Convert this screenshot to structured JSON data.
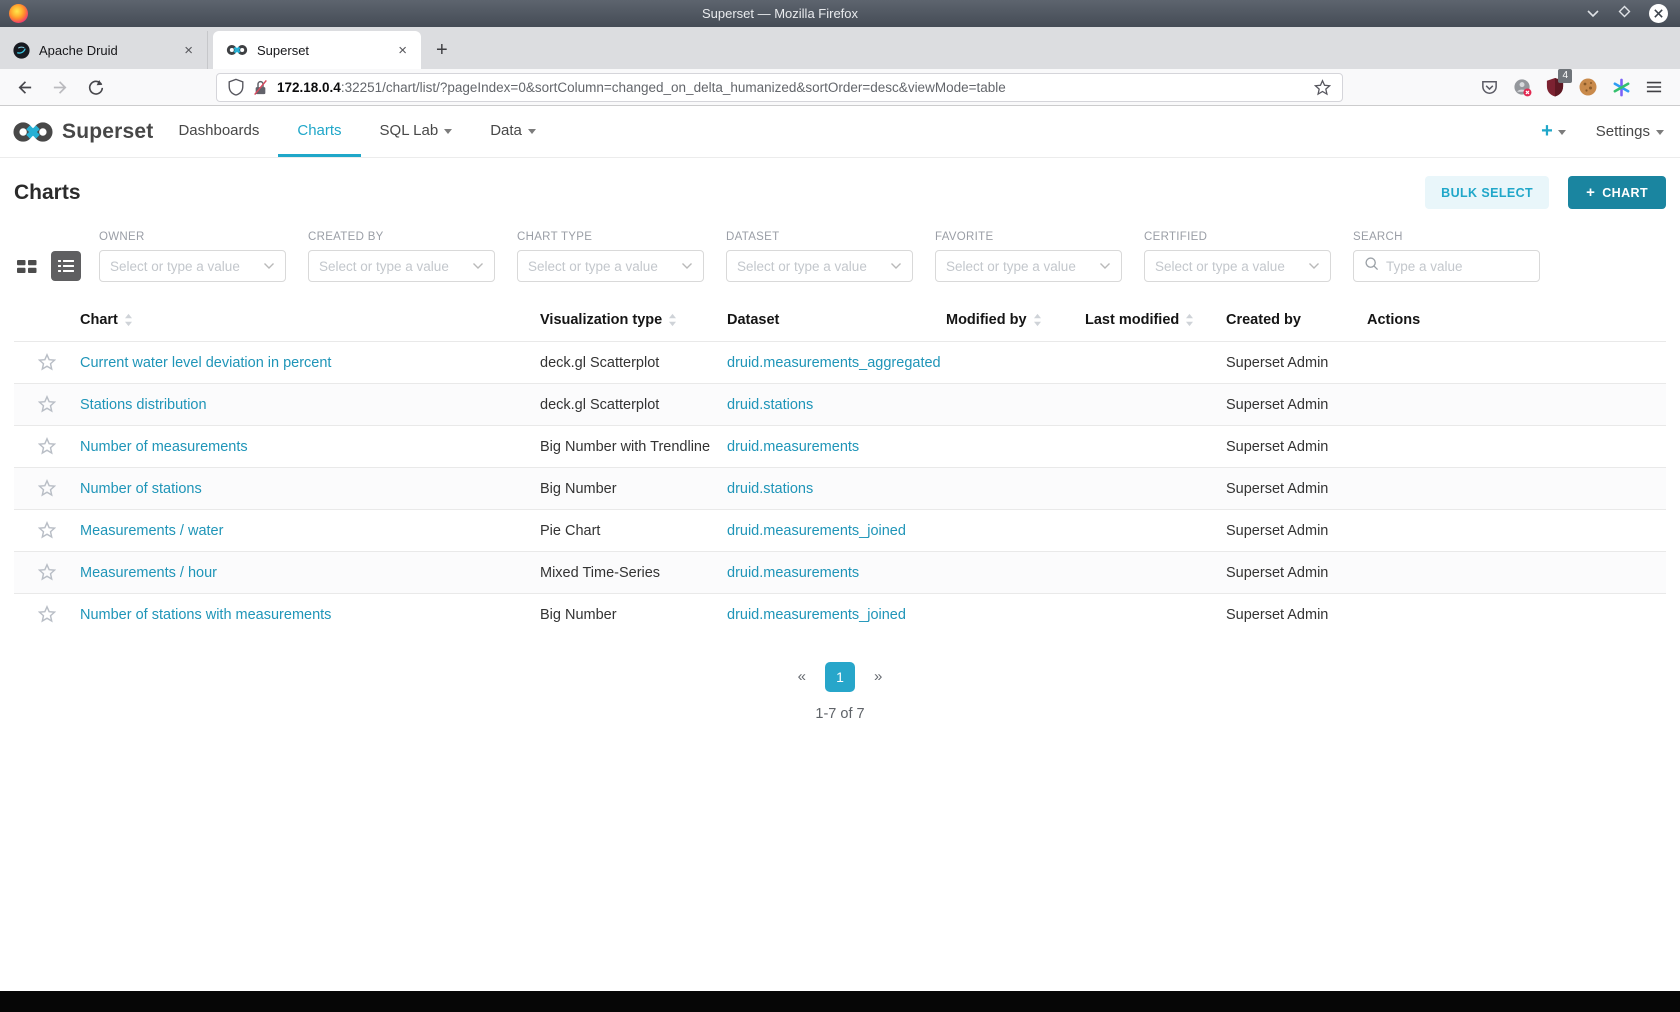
{
  "window": {
    "title": "Superset — Mozilla Firefox"
  },
  "browser": {
    "tabs": [
      {
        "label": "Apache Druid",
        "close_label": "×",
        "active": false
      },
      {
        "label": "Superset",
        "close_label": "×",
        "active": true
      }
    ],
    "new_tab_label": "+",
    "url_host": "172.18.0.4",
    "url_rest": ":32251/chart/list/?pageIndex=0&sortColumn=changed_on_delta_humanized&sortOrder=desc&viewMode=table",
    "extension_badge": "4"
  },
  "navbar": {
    "brand": "Superset",
    "items": [
      {
        "label": "Dashboards",
        "active": false,
        "caret": false
      },
      {
        "label": "Charts",
        "active": true,
        "caret": false
      },
      {
        "label": "SQL Lab",
        "active": false,
        "caret": true
      },
      {
        "label": "Data",
        "active": false,
        "caret": true
      }
    ],
    "plus_label": "+",
    "settings_label": "Settings"
  },
  "page": {
    "title": "Charts",
    "bulk_select_label": "BULK SELECT",
    "new_chart_plus": "+",
    "new_chart_label": "CHART"
  },
  "filters": [
    {
      "label": "OWNER",
      "placeholder": "Select or type a value",
      "type": "select"
    },
    {
      "label": "CREATED BY",
      "placeholder": "Select or type a value",
      "type": "select"
    },
    {
      "label": "CHART TYPE",
      "placeholder": "Select or type a value",
      "type": "select"
    },
    {
      "label": "DATASET",
      "placeholder": "Select or type a value",
      "type": "select"
    },
    {
      "label": "FAVORITE",
      "placeholder": "Select or type a value",
      "type": "select"
    },
    {
      "label": "CERTIFIED",
      "placeholder": "Select or type a value",
      "type": "select"
    },
    {
      "label": "SEARCH",
      "placeholder": "Type a value",
      "type": "search"
    }
  ],
  "table": {
    "columns": [
      {
        "label": "Chart",
        "sortable": true
      },
      {
        "label": "Visualization type",
        "sortable": true
      },
      {
        "label": "Dataset",
        "sortable": false
      },
      {
        "label": "Modified by",
        "sortable": true
      },
      {
        "label": "Last modified",
        "sortable": true
      },
      {
        "label": "Created by",
        "sortable": false
      },
      {
        "label": "Actions",
        "sortable": false
      }
    ],
    "rows": [
      {
        "chart": "Current water level deviation in percent",
        "visualization_type": "deck.gl Scatterplot",
        "dataset": "druid.measurements_aggregated",
        "modified_by": "",
        "last_modified": "",
        "created_by": "Superset Admin"
      },
      {
        "chart": "Stations distribution",
        "visualization_type": "deck.gl Scatterplot",
        "dataset": "druid.stations",
        "modified_by": "",
        "last_modified": "",
        "created_by": "Superset Admin"
      },
      {
        "chart": "Number of measurements",
        "visualization_type": "Big Number with Trendline",
        "dataset": "druid.measurements",
        "modified_by": "",
        "last_modified": "",
        "created_by": "Superset Admin"
      },
      {
        "chart": "Number of stations",
        "visualization_type": "Big Number",
        "dataset": "druid.stations",
        "modified_by": "",
        "last_modified": "",
        "created_by": "Superset Admin"
      },
      {
        "chart": "Measurements / water",
        "visualization_type": "Pie Chart",
        "dataset": "druid.measurements_joined",
        "modified_by": "",
        "last_modified": "",
        "created_by": "Superset Admin"
      },
      {
        "chart": "Measurements / hour",
        "visualization_type": "Mixed Time-Series",
        "dataset": "druid.measurements",
        "modified_by": "",
        "last_modified": "",
        "created_by": "Superset Admin"
      },
      {
        "chart": "Number of stations with measurements",
        "visualization_type": "Big Number",
        "dataset": "druid.measurements_joined",
        "modified_by": "",
        "last_modified": "",
        "created_by": "Superset Admin"
      }
    ]
  },
  "pagination": {
    "prev_label": "«",
    "pages": [
      "1"
    ],
    "next_label": "»",
    "summary": "1-7 of 7"
  },
  "colors": {
    "primary": "#20a7c9",
    "primary_dark": "#1a85a0",
    "link": "#1f95b8"
  }
}
